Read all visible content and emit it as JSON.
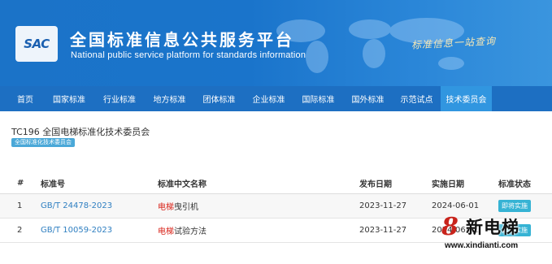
{
  "header": {
    "logo_text": "SAC",
    "title_cn": "全国标准信息公共服务平台",
    "title_en": "National public service platform  for standards information",
    "slogan": "标准信息一站查询"
  },
  "nav": {
    "items": [
      {
        "label": "首页",
        "active": false
      },
      {
        "label": "国家标准",
        "active": false
      },
      {
        "label": "行业标准",
        "active": false
      },
      {
        "label": "地方标准",
        "active": false
      },
      {
        "label": "团体标准",
        "active": false
      },
      {
        "label": "企业标准",
        "active": false
      },
      {
        "label": "国际标准",
        "active": false
      },
      {
        "label": "国外标准",
        "active": false
      },
      {
        "label": "示范试点",
        "active": false
      },
      {
        "label": "技术委员会",
        "active": true
      }
    ]
  },
  "committee": {
    "title": "TC196 全国电梯标准化技术委员会",
    "badge": "全国标准化技术委员会"
  },
  "table": {
    "headers": {
      "index": "#",
      "code": "标准号",
      "name": "标准中文名称",
      "publish": "发布日期",
      "implement": "实施日期",
      "status": "标准状态"
    },
    "rows": [
      {
        "index": "1",
        "code": "GB/T 24478-2023",
        "name_highlight": "电梯",
        "name_rest": "曳引机",
        "publish": "2023-11-27",
        "implement": "2024-06-01",
        "status": "即将实施"
      },
      {
        "index": "2",
        "code": "GB/T 10059-2023",
        "name_highlight": "电梯",
        "name_rest": "试验方法",
        "publish": "2023-11-27",
        "implement": "2024-06-01",
        "status": "即将实施"
      }
    ]
  },
  "watermark": {
    "mark": "8",
    "name": "新电梯",
    "url": "www.xindianti.com"
  },
  "colors": {
    "banner": "#1a74cb",
    "nav": "#1d6fc2",
    "nav_active": "#3196e0",
    "link": "#2f7fc1",
    "highlight": "#d9261c",
    "status": "#36b3d4"
  }
}
